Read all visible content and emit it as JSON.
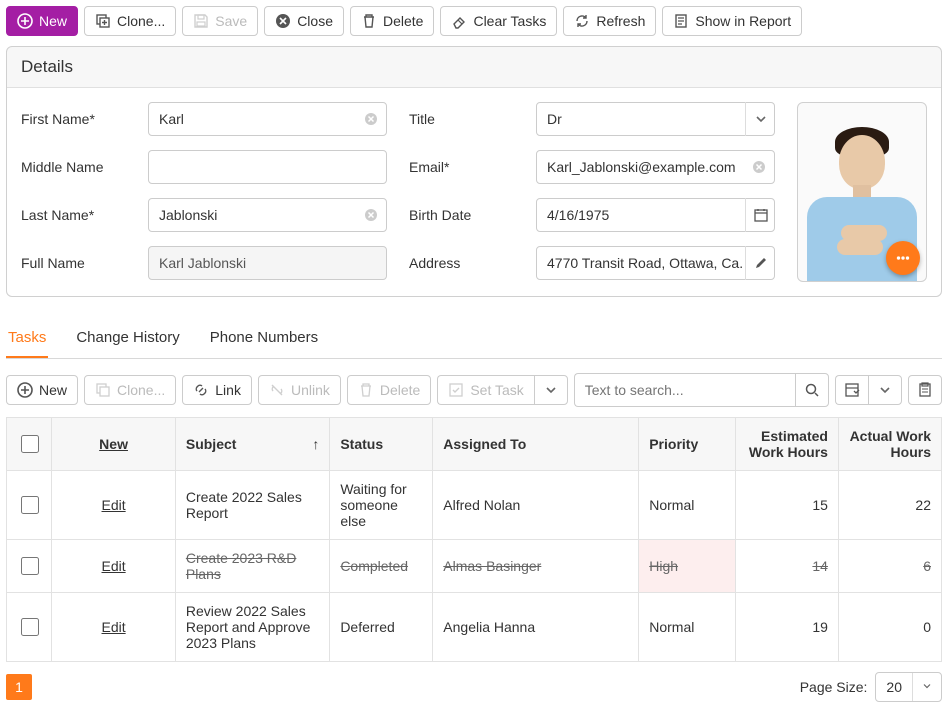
{
  "toolbar": {
    "new": "New",
    "clone": "Clone...",
    "save": "Save",
    "close": "Close",
    "delete": "Delete",
    "clear_tasks": "Clear Tasks",
    "refresh": "Refresh",
    "show_in_report": "Show in Report"
  },
  "details": {
    "title": "Details",
    "labels": {
      "first_name": "First Name*",
      "middle_name": "Middle Name",
      "last_name": "Last Name*",
      "full_name": "Full Name",
      "title": "Title",
      "email": "Email*",
      "birth_date": "Birth Date",
      "address": "Address"
    },
    "values": {
      "first_name": "Karl",
      "middle_name": "",
      "last_name": "Jablonski",
      "full_name": "Karl Jablonski",
      "title": "Dr",
      "email": "Karl_Jablonski@example.com",
      "birth_date": "4/16/1975",
      "address": "4770 Transit Road, Ottawa, Ca..."
    }
  },
  "tabs": {
    "tasks": "Tasks",
    "change_history": "Change History",
    "phone_numbers": "Phone Numbers"
  },
  "subtoolbar": {
    "new": "New",
    "clone": "Clone...",
    "link": "Link",
    "unlink": "Unlink",
    "delete": "Delete",
    "set_task": "Set Task",
    "search_placeholder": "Text to search..."
  },
  "grid": {
    "headers": {
      "new_link": "New",
      "subject": "Subject",
      "status": "Status",
      "assigned_to": "Assigned To",
      "priority": "Priority",
      "est_hours": "Estimated Work Hours",
      "act_hours": "Actual Work Hours"
    },
    "edit_label": "Edit",
    "rows": [
      {
        "subject": "Create 2022 Sales Report",
        "status": "Waiting for someone else",
        "assigned_to": "Alfred Nolan",
        "priority": "Normal",
        "est": "15",
        "act": "22",
        "completed": false
      },
      {
        "subject": "Create 2023 R&D Plans",
        "status": "Completed",
        "assigned_to": "Almas Basinger",
        "priority": "High",
        "est": "14",
        "act": "6",
        "completed": true
      },
      {
        "subject": "Review 2022 Sales Report and Approve 2023 Plans",
        "status": "Deferred",
        "assigned_to": "Angelia Hanna",
        "priority": "Normal",
        "est": "19",
        "act": "0",
        "completed": false
      }
    ]
  },
  "pager": {
    "page": "1",
    "page_size_label": "Page Size:",
    "page_size_value": "20"
  }
}
